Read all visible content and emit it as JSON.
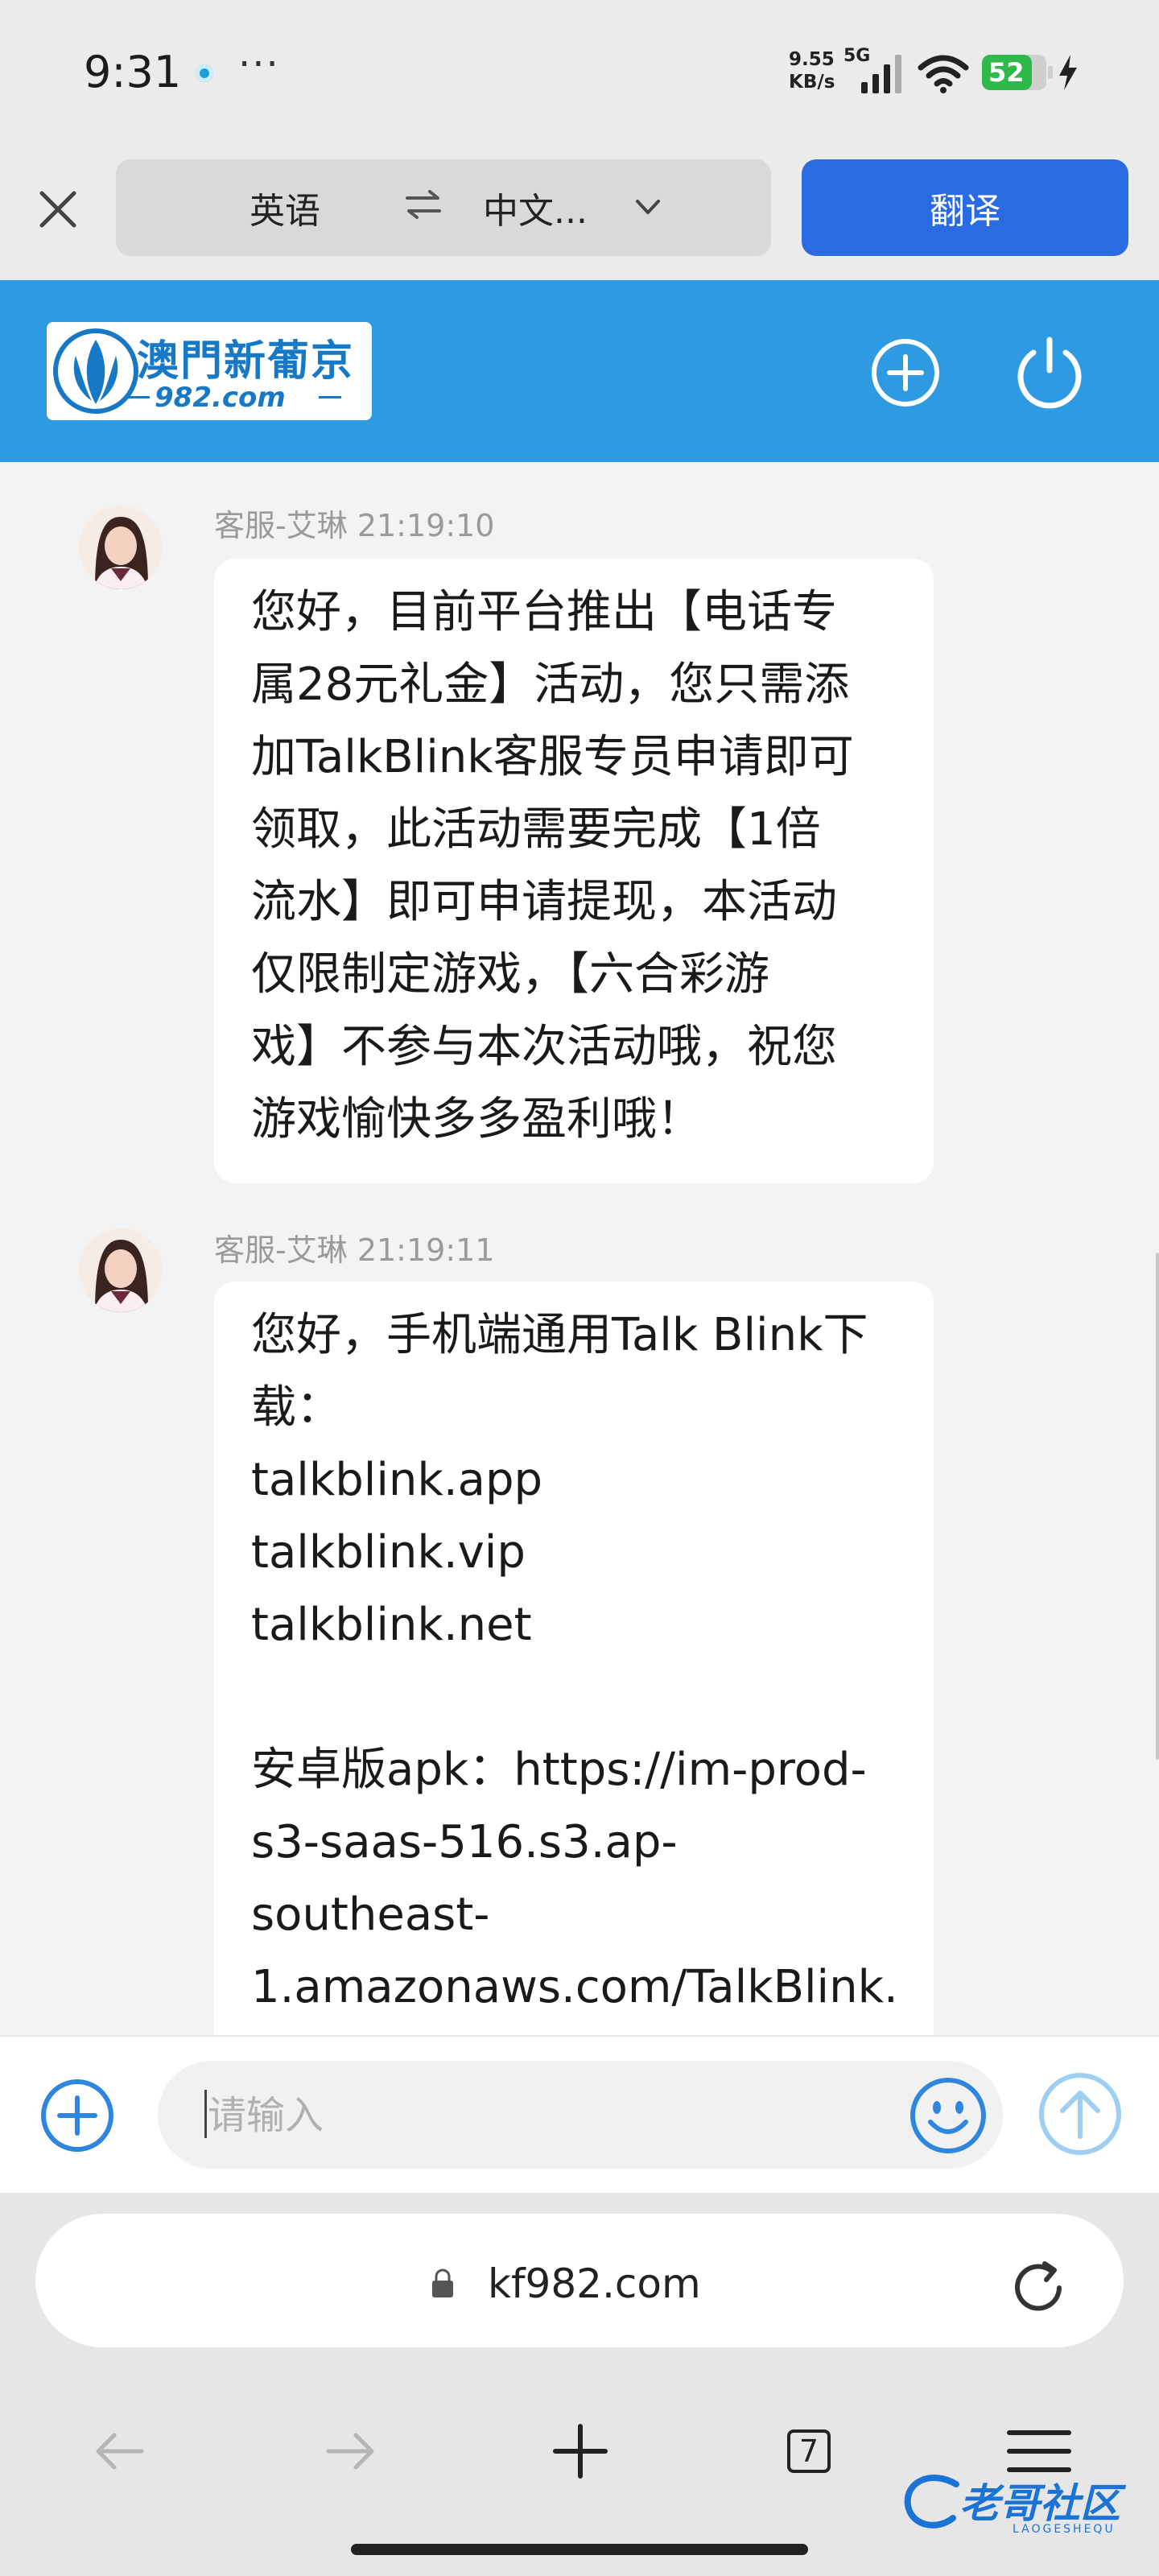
{
  "status_bar": {
    "time": "9:31",
    "more": "···",
    "net_speed_value": "9.55",
    "net_speed_unit": "KB/s",
    "network": "5G",
    "battery": "52",
    "battery_color": "#2fb94a"
  },
  "translate_bar": {
    "source_lang": "英语",
    "target_lang": "中文...",
    "translate_button": "翻译",
    "accent": "#2b6be2"
  },
  "site": {
    "logo_text": "澳門新葡京",
    "logo_sub": "982.com",
    "header_color": "#2e9ae1"
  },
  "messages": [
    {
      "sender": "客服-艾琳",
      "time": "21:19:10",
      "text": "您好，目前平台推出【电话专\n属28元礼金】活动，您只需添\n加TalkBlink客服专员申请即可\n领取，此活动需要完成【1倍\n流水】即可申请提现，本活动\n仅限制定游戏，【六合彩游\n戏】不参与本次活动哦，祝您\n游戏愉快多多盈利哦！"
    },
    {
      "sender": "客服-艾琳",
      "time": "21:19:11",
      "text": "您好，手机端通用Talk Blink下\n载：\ntalkblink.app\ntalkblink.vip\ntalkblink.net\n\n安卓版apk：https://im-prod-\ns3-saas-516.s3.ap-\nsoutheast-\n1.amazonaws.com/TalkBlink."
    }
  ],
  "input": {
    "placeholder": "请输入"
  },
  "browser": {
    "url": "kf982.com",
    "tab_count": "7"
  },
  "watermark": {
    "text": "老哥社区",
    "sub": "LAOGESHEQU"
  }
}
